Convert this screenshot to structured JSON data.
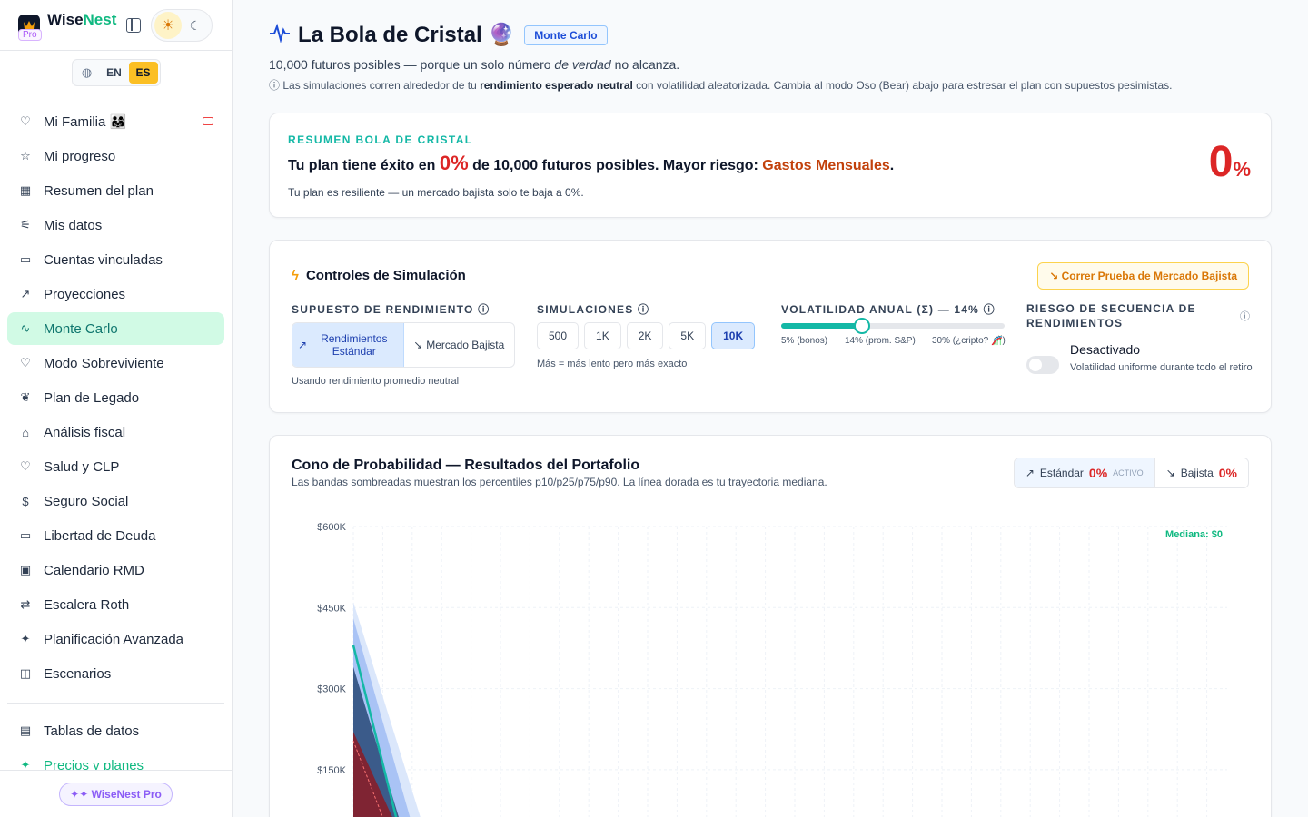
{
  "brand": {
    "name_a": "Wise",
    "name_b": "Nest",
    "tier": "Pro"
  },
  "lang": {
    "en": "EN",
    "es": "ES"
  },
  "nav": [
    {
      "label": "Mi Familia 👨‍👩‍👧",
      "icon": "heart-icon",
      "name": "sidebar-item-mi-familia"
    },
    {
      "label": "Mi progreso",
      "icon": "star-icon",
      "name": "sidebar-item-mi-progreso"
    },
    {
      "label": "Resumen del plan",
      "icon": "grid-icon",
      "name": "sidebar-item-resumen"
    },
    {
      "label": "Mis datos",
      "icon": "sliders-icon",
      "name": "sidebar-item-mis-datos"
    },
    {
      "label": "Cuentas vinculadas",
      "icon": "bank-card-icon",
      "name": "sidebar-item-cuentas"
    },
    {
      "label": "Proyecciones",
      "icon": "trend-icon",
      "name": "sidebar-item-proyecciones"
    },
    {
      "label": "Monte Carlo",
      "icon": "pulse-icon",
      "name": "sidebar-item-monte-carlo"
    },
    {
      "label": "Modo Sobreviviente",
      "icon": "heart-icon",
      "name": "sidebar-item-sobreviviente"
    },
    {
      "label": "Plan de Legado",
      "icon": "leaf-icon",
      "name": "sidebar-item-legado"
    },
    {
      "label": "Análisis fiscal",
      "icon": "landmark-icon",
      "name": "sidebar-item-fiscal"
    },
    {
      "label": "Salud y CLP",
      "icon": "heart-pulse-icon",
      "name": "sidebar-item-salud"
    },
    {
      "label": "Seguro Social",
      "icon": "dollar-icon",
      "name": "sidebar-item-seguro"
    },
    {
      "label": "Libertad de Deuda",
      "icon": "credit-card-icon",
      "name": "sidebar-item-deuda"
    },
    {
      "label": "Calendario RMD",
      "icon": "calendar-icon",
      "name": "sidebar-item-rmd"
    },
    {
      "label": "Escalera Roth",
      "icon": "arrows-icon",
      "name": "sidebar-item-roth"
    },
    {
      "label": "Planificación Avanzada",
      "icon": "sparkles-icon",
      "name": "sidebar-item-avanzada"
    },
    {
      "label": "Escenarios",
      "icon": "layers-icon",
      "name": "sidebar-item-escenarios"
    }
  ],
  "nav_bottom": [
    {
      "label": "Tablas de datos",
      "icon": "table-icon",
      "name": "sidebar-item-tablas"
    },
    {
      "label": "Precios y planes",
      "icon": "sparkles-icon",
      "name": "sidebar-item-precios"
    }
  ],
  "footer_pill": "✦✦ WiseNest Pro",
  "header": {
    "title": "La Bola de Cristal 🔮",
    "badge": "Monte Carlo",
    "subtitle_a": "10,000 futuros posibles — porque un solo número ",
    "subtitle_em": "de verdad",
    "subtitle_b": " no alcanza.",
    "info_a": "Las simulaciones corren alrededor de tu ",
    "info_bold": "rendimiento esperado neutral",
    "info_b": " con volatilidad aleatorizada. Cambia al modo Oso (Bear) abajo para estresar el plan con supuestos pesimistas."
  },
  "summary": {
    "label": "RESUMEN BOLA DE CRISTAL",
    "main_a": "Tu plan tiene éxito en ",
    "main_pct": "0%",
    "main_b": " de 10,000 futuros posibles. Mayor riesgo: ",
    "main_risk": "Gastos Mensuales",
    "main_c": ".",
    "sub": "Tu plan es resiliente — un mercado bajista solo te baja a 0%.",
    "big_num": "0",
    "big_unit": "%"
  },
  "controls": {
    "title": "Controles de Simulación",
    "bear_button": "Correr Prueba de Mercado Bajista",
    "return_label": "SUPUESTO DE RENDIMIENTO",
    "return_options": [
      "Rendimientos Estándar",
      "Mercado Bajista"
    ],
    "return_note": "Usando rendimiento promedio neutral",
    "sims_label": "SIMULACIONES",
    "sims_options": [
      "500",
      "1K",
      "2K",
      "5K",
      "10K"
    ],
    "sims_selected": "10K",
    "sims_note": "Más = más lento pero más exacto",
    "vol_label": "VOLATILIDAD ANUAL (Σ) — 14%",
    "vol_value": 0.14,
    "vol_min_label": "5% (bonos)",
    "vol_mid_label": "14% (prom. S&P)",
    "vol_max_label": "30% (¿cripto? 🎢)",
    "seq_label": "RIESGO DE SECUENCIA DE RENDIMIENTOS",
    "seq_state": "Desactivado",
    "seq_desc": "Volatilidad uniforme durante todo el retiro"
  },
  "chart_header": {
    "title": "Cono de Probabilidad — Resultados del Portafolio",
    "subtitle": "Las bandas sombreadas muestran los percentiles p10/p25/p75/p90. La línea dorada es tu trayectoria mediana.",
    "std_label": "Estándar",
    "std_pct": "0%",
    "std_tag": "ACTIVO",
    "bear_label": "Bajista",
    "bear_pct": "0%"
  },
  "chart_data": {
    "type": "area",
    "title": "Cono de Probabilidad — Resultados del Portafolio",
    "ylabel": "",
    "xlabel": "",
    "y_ticks": [
      "$600K",
      "$450K",
      "$300K",
      "$150K"
    ],
    "y_tick_values": [
      600000,
      450000,
      300000,
      150000
    ],
    "ylim": [
      0,
      600000
    ],
    "annotation": "Mediana: $0",
    "series": [
      {
        "values": [
          460000,
          0
        ]
      },
      {
        "values": [
          430000,
          0
        ]
      },
      {
        "values": [
          380000,
          0
        ]
      },
      {
        "values": [
          340000,
          0
        ]
      },
      {
        "values": [
          220000,
          0
        ]
      }
    ],
    "colors": {
      "p90": "#dbe7fb",
      "p75": "#a9c3f5",
      "p25": "#3b5b8a",
      "p10": "#7f2433",
      "median": "#14b8a6"
    }
  }
}
